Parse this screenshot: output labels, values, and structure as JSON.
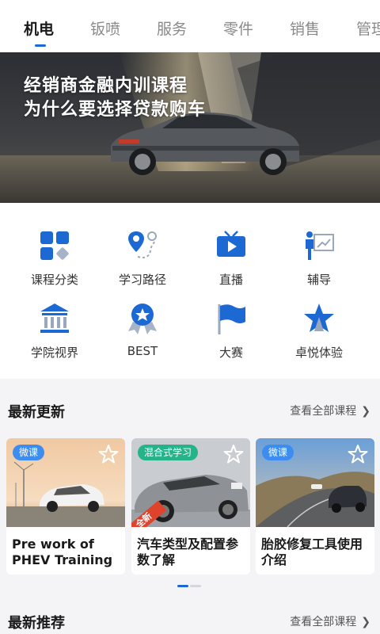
{
  "tabs": [
    "机电",
    "钣喷",
    "服务",
    "零件",
    "销售",
    "管理"
  ],
  "active_tab": "机电",
  "banner": {
    "line1": "经销商金融内训课程",
    "line2": "为什么要选择贷款购车"
  },
  "grid": [
    {
      "label": "课程分类",
      "icon": "category-icon"
    },
    {
      "label": "学习路径",
      "icon": "route-icon"
    },
    {
      "label": "直播",
      "icon": "tv-live-icon"
    },
    {
      "label": "辅导",
      "icon": "tutor-icon"
    },
    {
      "label": "学院视界",
      "icon": "academy-icon"
    },
    {
      "label": "BEST",
      "icon": "best-medal-icon"
    },
    {
      "label": "大赛",
      "icon": "flag-icon"
    },
    {
      "label": "卓悦体验",
      "icon": "star-icon"
    }
  ],
  "latest": {
    "title": "最新更新",
    "more": "查看全部课程",
    "cards": [
      {
        "tag": "微课",
        "title": "Pre work of PHEV Training",
        "tag_color": "#3d8cf0"
      },
      {
        "tag": "混合式学习",
        "title": "汽车类型及配置参数了解",
        "tag_color": "#26b38a",
        "badge": "全新"
      },
      {
        "tag": "微课",
        "title": "胎胶修复工具使用介绍",
        "tag_color": "#3d8cf0"
      }
    ]
  },
  "recommend": {
    "title": "最新推荐",
    "more": "查看全部课程"
  },
  "colors": {
    "accent": "#1c69d4",
    "icon_blue": "#1c69d4"
  }
}
